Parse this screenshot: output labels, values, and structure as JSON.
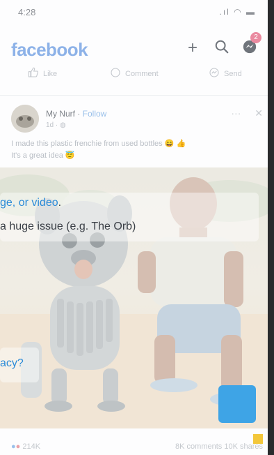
{
  "status": {
    "time": "4:28",
    "signal_icon": "signal-icon",
    "wifi_icon": "wifi-icon",
    "battery_icon": "battery-icon"
  },
  "header": {
    "logo": "facebook",
    "plus_icon": "plus-icon",
    "search_icon": "search-icon",
    "messenger_icon": "messenger-icon",
    "messenger_badge": "2"
  },
  "actions": {
    "like": "Like",
    "comment": "Comment",
    "send": "Send"
  },
  "post": {
    "author": "My Nurf",
    "separator": " · ",
    "follow": "Follow",
    "meta": "1d · ",
    "caption_line1": "I made this plastic frenchie from used bottles 😄 👍",
    "caption_line2": "It's a great idea 😇",
    "reactions_count": "214K",
    "comments": "8K comments",
    "shares": "10K shares"
  },
  "overlay": {
    "line1_link": "ge, or video",
    "line1_tail": ".",
    "line2": "a huge issue (e.g. The Orb)",
    "line3_link": "acy?"
  },
  "colors": {
    "accent": "#3ea4e6",
    "yellow": "#f3c73b",
    "facebook_blue": "#8db2e8"
  }
}
